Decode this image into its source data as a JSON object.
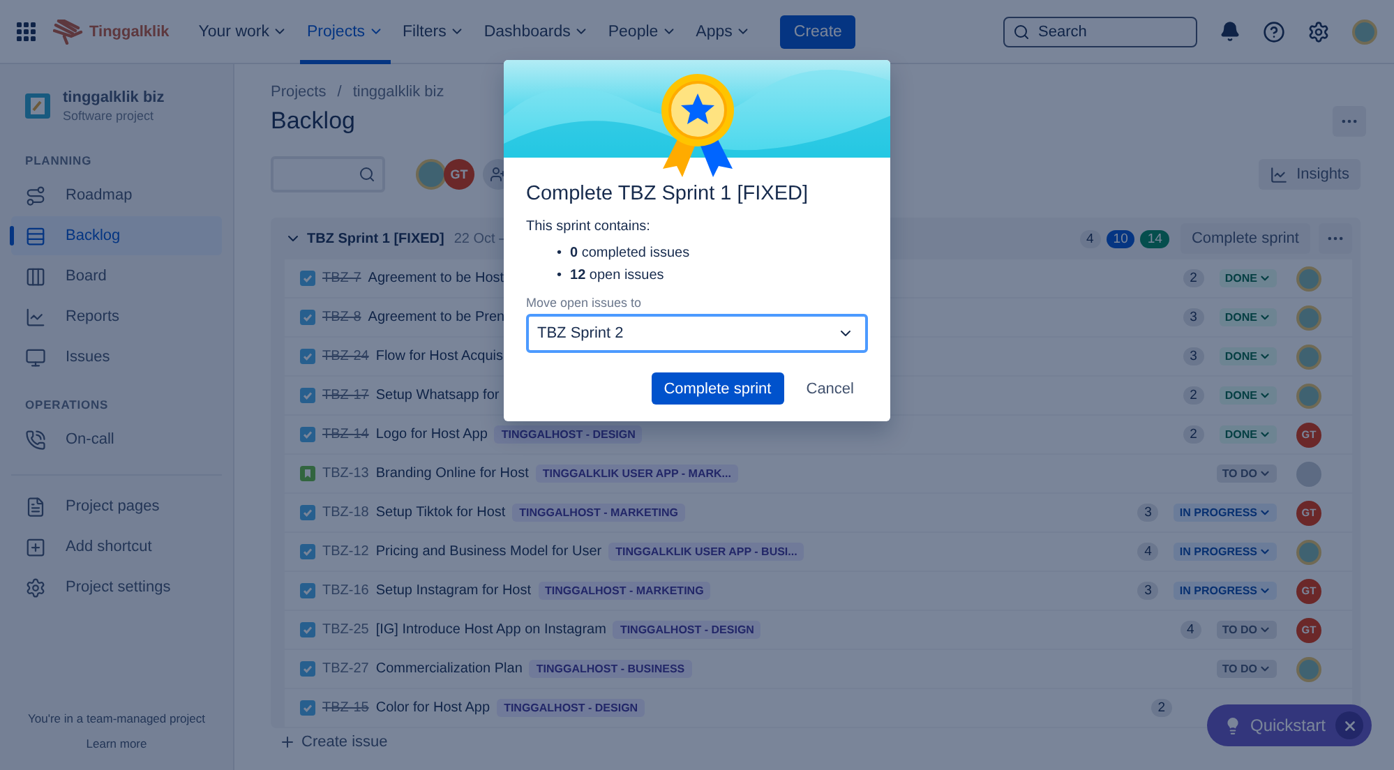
{
  "top_nav": {
    "logo": "Tinggalklik",
    "items": [
      {
        "label": "Your work",
        "selected": false
      },
      {
        "label": "Projects",
        "selected": true
      },
      {
        "label": "Filters",
        "selected": false
      },
      {
        "label": "Dashboards",
        "selected": false
      },
      {
        "label": "People",
        "selected": false
      },
      {
        "label": "Apps",
        "selected": false
      }
    ],
    "create": "Create",
    "search": {
      "placeholder": "Search"
    }
  },
  "sidebar": {
    "project": {
      "name": "tinggalklik biz",
      "type": "Software project"
    },
    "sections": [
      {
        "heading": "PLANNING",
        "items": [
          {
            "label": "Roadmap",
            "kind": "roadmap",
            "selected": false
          },
          {
            "label": "Backlog",
            "kind": "backlog",
            "selected": true
          },
          {
            "label": "Board",
            "kind": "board",
            "selected": false
          },
          {
            "label": "Reports",
            "kind": "reports",
            "selected": false
          },
          {
            "label": "Issues",
            "kind": "issues",
            "selected": false
          }
        ]
      },
      {
        "heading": "OPERATIONS",
        "items": [
          {
            "label": "On-call",
            "kind": "oncall",
            "selected": false
          }
        ]
      }
    ],
    "links": [
      {
        "label": "Project pages",
        "kind": "pages"
      },
      {
        "label": "Add shortcut",
        "kind": "shortcut"
      },
      {
        "label": "Project settings",
        "kind": "settings"
      }
    ],
    "footer": {
      "text": "You're in a team-managed project",
      "link": "Learn more"
    }
  },
  "page": {
    "breadcrumbs": [
      "Projects",
      "tinggalklik biz"
    ],
    "breadcrumb_separator": "/",
    "title": "Backlog",
    "members": [
      {
        "kind": "photo"
      },
      {
        "kind": "initials",
        "initials": "GT"
      }
    ],
    "insights": "Insights"
  },
  "sprint": {
    "name": "TBZ Sprint 1 [FIXED]",
    "dates": "22 Oct –",
    "expanded": true,
    "counts": [
      {
        "value": "4",
        "kind": "todo"
      },
      {
        "value": "10",
        "kind": "inprogress"
      },
      {
        "value": "14",
        "kind": "done"
      }
    ],
    "action": "Complete sprint",
    "create": "Create issue",
    "issues": [
      {
        "kind": "task",
        "key": "TBZ-7",
        "done": true,
        "title": "Agreement to be Host",
        "points": "2",
        "status": {
          "text": "DONE",
          "kind": "done"
        },
        "assignee": {
          "kind": "photo"
        }
      },
      {
        "kind": "task",
        "key": "TBZ-8",
        "done": true,
        "title": "Agreement to be Pren",
        "points": "3",
        "status": {
          "text": "DONE",
          "kind": "done"
        },
        "assignee": {
          "kind": "photo"
        }
      },
      {
        "kind": "task",
        "key": "TBZ-24",
        "done": true,
        "title": "Flow for Host Acquis",
        "points": "3",
        "status": {
          "text": "DONE",
          "kind": "done"
        },
        "assignee": {
          "kind": "photo"
        }
      },
      {
        "kind": "task",
        "key": "TBZ-17",
        "done": true,
        "title": "Setup Whatsapp for",
        "points": "2",
        "status": {
          "text": "DONE",
          "kind": "done"
        },
        "assignee": {
          "kind": "photo"
        }
      },
      {
        "kind": "task",
        "key": "TBZ-14",
        "done": true,
        "title": "Logo for Host App",
        "label": "TINGGALHOST - DESIGN",
        "points": "2",
        "status": {
          "text": "DONE",
          "kind": "done"
        },
        "assignee": {
          "kind": "initials",
          "initials": "GT"
        }
      },
      {
        "kind": "story",
        "key": "TBZ-13",
        "done": false,
        "title": "Branding Online for Host",
        "label": "TINGGALKLIK USER APP - MARK...",
        "status": {
          "text": "TO DO",
          "kind": "todo"
        },
        "assignee": {
          "kind": "unassigned"
        }
      },
      {
        "kind": "task",
        "key": "TBZ-18",
        "done": false,
        "title": "Setup Tiktok for Host",
        "label": "TINGGALHOST - MARKETING",
        "points": "3",
        "status": {
          "text": "IN PROGRESS",
          "kind": "inprogress"
        },
        "assignee": {
          "kind": "initials",
          "initials": "GT"
        }
      },
      {
        "kind": "task",
        "key": "TBZ-12",
        "done": false,
        "title": "Pricing and Business Model for User",
        "label": "TINGGALKLIK USER APP - BUSI...",
        "points": "4",
        "status": {
          "text": "IN PROGRESS",
          "kind": "inprogress"
        },
        "assignee": {
          "kind": "photo"
        }
      },
      {
        "kind": "task",
        "key": "TBZ-16",
        "done": false,
        "title": "Setup Instagram for Host",
        "label": "TINGGALHOST - MARKETING",
        "points": "3",
        "status": {
          "text": "IN PROGRESS",
          "kind": "inprogress"
        },
        "assignee": {
          "kind": "initials",
          "initials": "GT"
        }
      },
      {
        "kind": "task",
        "key": "TBZ-25",
        "done": false,
        "title": "[IG] Introduce Host App on Instagram",
        "label": "TINGGALHOST - DESIGN",
        "points": "4",
        "status": {
          "text": "TO DO",
          "kind": "todo"
        },
        "assignee": {
          "kind": "initials",
          "initials": "GT"
        }
      },
      {
        "kind": "task",
        "key": "TBZ-27",
        "done": false,
        "title": "Commercialization Plan",
        "label": "TINGGALHOST - BUSINESS",
        "status": {
          "text": "TO DO",
          "kind": "todo"
        },
        "assignee": {
          "kind": "photo"
        }
      },
      {
        "kind": "task",
        "key": "TBZ-15",
        "done": true,
        "title": "Color for Host App",
        "label": "TINGGALHOST - DESIGN",
        "points": "2"
      }
    ]
  },
  "modal": {
    "title": "Complete TBZ Sprint 1 [FIXED]",
    "intro": "This sprint contains:",
    "items": [
      {
        "bullet": "•",
        "text": "**0** completed issues"
      },
      {
        "bullet": "•",
        "text": "**12** open issues"
      }
    ],
    "field_label": "Move open issues to",
    "select_value": "TBZ Sprint 2",
    "primary": "Complete sprint",
    "secondary": "Cancel"
  },
  "quickstart": {
    "label": "Quickstart"
  }
}
